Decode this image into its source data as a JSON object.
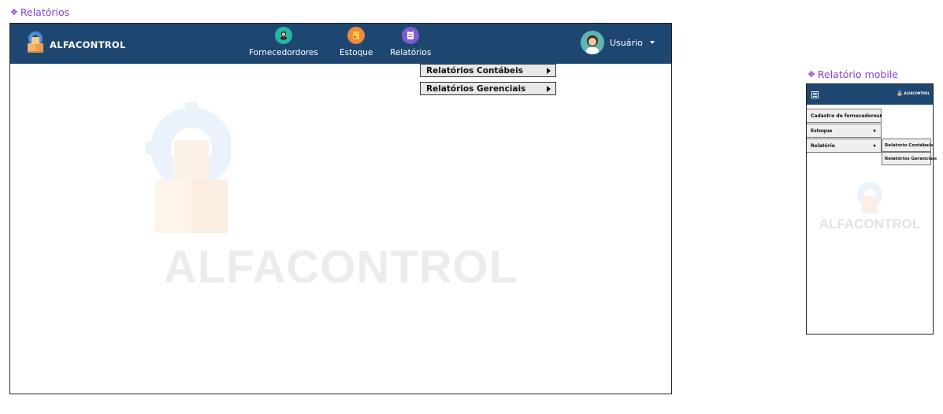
{
  "desktop": {
    "frame_title": "Relatórios",
    "brand": "ALFACONTROL",
    "nav": [
      {
        "label": "Fornecedordores",
        "icon": "supplier-icon"
      },
      {
        "label": "Estoque",
        "icon": "box-icon"
      },
      {
        "label": "Relatórios",
        "icon": "clipboard-icon"
      }
    ],
    "user": {
      "name": "Usuário",
      "icon": "user-avatar-icon"
    },
    "dropdown": [
      "Relatórios Contábeis",
      "Relatórios Gerenciais"
    ],
    "watermark": "ALFACONTROL"
  },
  "mobile": {
    "frame_title": "Relatório mobile",
    "brand": "ALFACONTROL",
    "menu": [
      "Cadastro de fornecedores",
      "Estoque",
      "Relatório"
    ],
    "submenu": [
      "Relatório Contábeis",
      "Relatórios Gerenciais"
    ],
    "watermark": "ALFACONTROL"
  },
  "colors": {
    "nav": "#1d4770",
    "title": "#8b3fd9",
    "watermark": "#ececec"
  }
}
